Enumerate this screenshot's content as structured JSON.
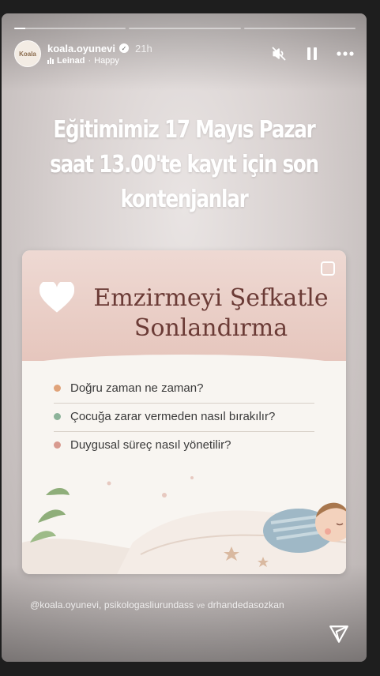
{
  "progress": [
    0.1,
    0,
    0
  ],
  "header": {
    "username": "koala.oyunevi",
    "time": "21h",
    "music_artist": "Leinad",
    "music_separator": "·",
    "music_title": "Happy",
    "avatar_text": "Koala"
  },
  "story": {
    "headline": "Eğitimimiz 17 Mayıs Pazar saat 13.00'te kayıt için son kontenjanlar",
    "card_title": "Emzirmeyi Şefkatle Sonlandırma",
    "bullets": [
      {
        "text": "Doğru zaman ne zaman?",
        "color": "#e0a37a"
      },
      {
        "text": "Çocuğa zarar vermeden nasıl bırakılır?",
        "color": "#8db39a"
      },
      {
        "text": "Duygusal süreç nasıl yönetilir?",
        "color": "#d89a8f"
      }
    ]
  },
  "mentions": {
    "user1": "@koala.oyunevi,",
    "user2": "psikologasliurundass",
    "joiner": "ve",
    "user3": "drhandedasozkan"
  }
}
